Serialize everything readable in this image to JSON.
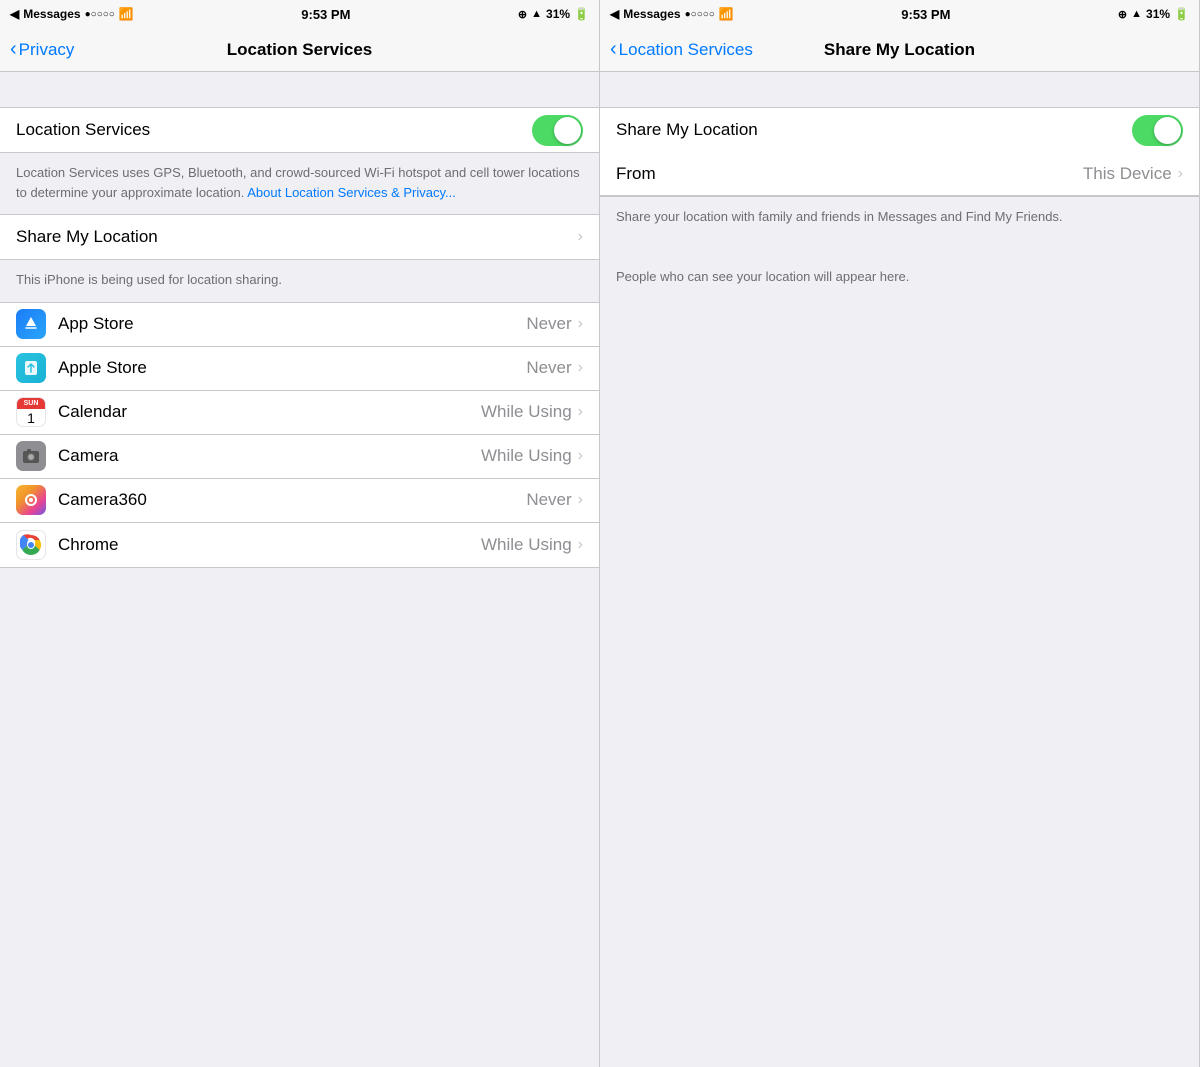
{
  "left_panel": {
    "status_bar": {
      "carrier": "Messages",
      "signal": "●○○○○",
      "wifi": "WiFi",
      "time": "9:53 PM",
      "lock": "🔒",
      "location": "▲",
      "battery": "31%"
    },
    "nav": {
      "back_label": "Privacy",
      "title": "Location Services"
    },
    "location_services": {
      "label": "Location Services",
      "toggle_on": true
    },
    "description": "Location Services uses GPS, Bluetooth, and crowd-sourced Wi-Fi hotspot and cell tower locations to determine your approximate location.",
    "about_link": "About Location Services & Privacy...",
    "share_my_location": {
      "label": "Share My Location",
      "chevron": "›"
    },
    "share_description": "This iPhone is being used for location sharing.",
    "apps": [
      {
        "name": "App Store",
        "value": "Never",
        "icon_type": "appstore"
      },
      {
        "name": "Apple Store",
        "value": "Never",
        "icon_type": "applestore"
      },
      {
        "name": "Calendar",
        "value": "While Using",
        "icon_type": "calendar"
      },
      {
        "name": "Camera",
        "value": "While Using",
        "icon_type": "camera"
      },
      {
        "name": "Camera360",
        "value": "Never",
        "icon_type": "camera360"
      },
      {
        "name": "Chrome",
        "value": "While Using",
        "icon_type": "chrome"
      }
    ]
  },
  "right_panel": {
    "status_bar": {
      "carrier": "Messages",
      "signal": "●○○○○",
      "wifi": "WiFi",
      "time": "9:53 PM",
      "lock": "🔒",
      "location": "▲",
      "battery": "31%"
    },
    "nav": {
      "back_label": "Location Services",
      "title": "Share My Location"
    },
    "share_my_location": {
      "label": "Share My Location",
      "toggle_on": true
    },
    "from": {
      "label": "From",
      "value": "This Device",
      "chevron": "›"
    },
    "description": "Share your location with family and friends in Messages and Find My Friends.",
    "people_description": "People who can see your location will appear here."
  }
}
